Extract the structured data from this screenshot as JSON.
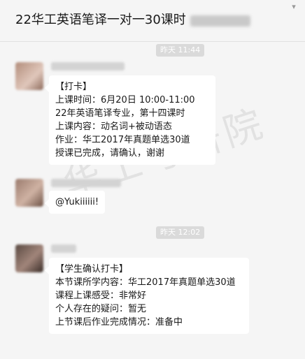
{
  "header": {
    "title": "22华工英语笔译一对一30课时",
    "menu_icon": "chevron-down-icon"
  },
  "messages": {
    "time1": "昨天 11:44",
    "msg1_lines": [
      "【打卡】",
      "上课时间：6月20日 10:00-11:00",
      "22年英语笔译专业，第十四课时",
      "上课内容：动名词+被动语态",
      "作业：华工2017年真题单选30道",
      "授课已完成，请确认，谢谢"
    ],
    "msg2_text": "@Yukiiiiii!",
    "time2": "昨天 12:02",
    "msg3_lines": [
      "【学生确认打卡】",
      "本节课所学内容：华工2017年真题单选30道",
      "课程上课感受：非常好",
      "个人存在的疑问：暂无",
      "上节课后作业完成情况：准备中"
    ]
  },
  "watermark": "华工考研院"
}
